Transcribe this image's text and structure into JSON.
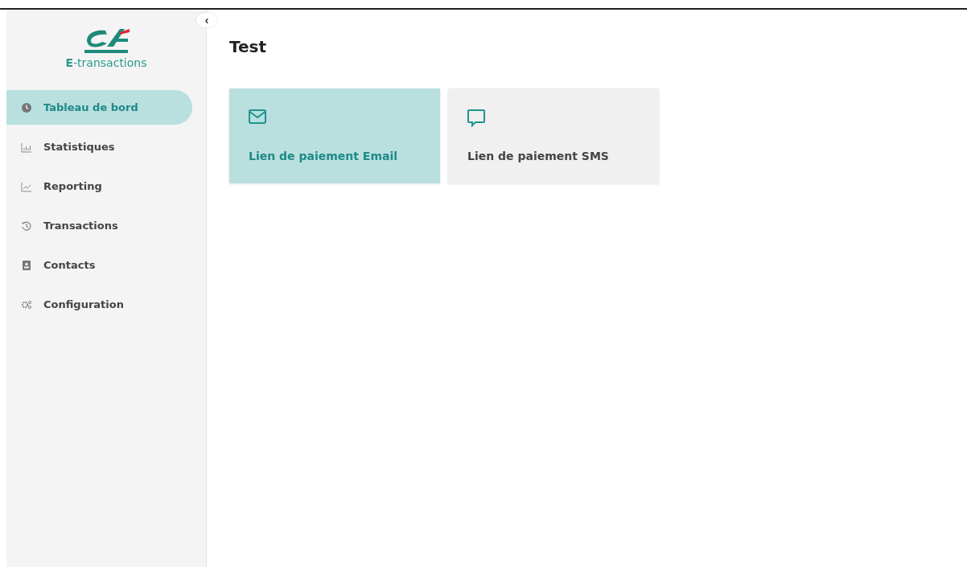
{
  "sidebar": {
    "logo_text": "**E**-transactions",
    "collapse": "‹",
    "items": [
      {
        "label": "Tableau de bord",
        "kind": "clock",
        "selected": true
      },
      {
        "label": "Statistiques",
        "kind": "bars",
        "selected": false
      },
      {
        "label": "Reporting",
        "kind": "trend",
        "selected": false
      },
      {
        "label": "Transactions",
        "kind": "history",
        "selected": false
      },
      {
        "label": "Contacts",
        "kind": "contact",
        "selected": false
      },
      {
        "label": "Configuration",
        "kind": "gears",
        "selected": false
      }
    ]
  },
  "page": {
    "title": "Test",
    "cards": [
      {
        "label": "Lien de paiement Email",
        "kind": "email",
        "selected": true
      },
      {
        "label": "Lien de paiement SMS",
        "kind": "sms",
        "selected": false
      }
    ]
  }
}
